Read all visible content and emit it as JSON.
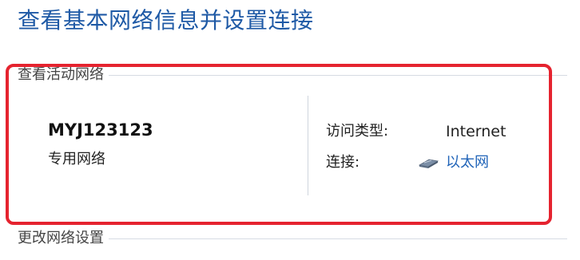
{
  "page": {
    "title": "查看基本网络信息并设置连接"
  },
  "active_networks": {
    "header": "查看活动网络",
    "network": {
      "name": "MYJ123123",
      "profile": "专用网络"
    },
    "access_type": {
      "label": "访问类型:",
      "value": "Internet"
    },
    "connections": {
      "label": "连接:",
      "value": "以太网",
      "icon": "ethernet-icon"
    }
  },
  "change_settings": {
    "header": "更改网络设置"
  },
  "colors": {
    "title": "#1f5aa6",
    "link": "#1f63b8",
    "highlight": "#e5232f"
  }
}
